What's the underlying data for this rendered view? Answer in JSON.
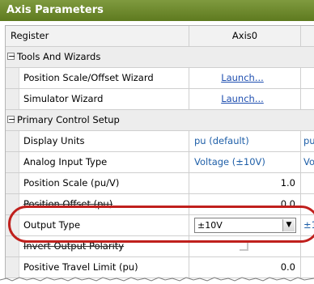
{
  "panel": {
    "title": "Axis Parameters"
  },
  "header": {
    "col_register": "Register",
    "col_axis": "Axis0"
  },
  "categories": {
    "tools": "Tools And Wizards",
    "primary": "Primary Control Setup"
  },
  "tools": {
    "position_scale_wizard": {
      "label": "Position Scale/Offset Wizard",
      "action": "Launch..."
    },
    "simulator_wizard": {
      "label": "Simulator Wizard",
      "action": "Launch..."
    }
  },
  "primary": {
    "display_units": {
      "label": "Display Units",
      "value": "pu (default)",
      "extra": "pu"
    },
    "analog_input_type": {
      "label": "Analog Input Type",
      "value": "Voltage (±10V)",
      "extra": "Vol"
    },
    "position_scale": {
      "label": "Position Scale (pu/V)",
      "value": "1.0"
    },
    "position_offset": {
      "label": "Position Offset (pu)",
      "value": "0.0"
    },
    "output_type": {
      "label": "Output Type",
      "value": "±10V",
      "extra": "±1"
    },
    "invert_output_polarity": {
      "label": "Invert Output Polarity",
      "checked": false
    },
    "positive_travel_limit": {
      "label": "Positive Travel Limit (pu)",
      "value": "0.0"
    }
  },
  "colors": {
    "title_bar": "#6a8a2a",
    "highlight": "#c0201d",
    "value_text": "#1f5fa8"
  }
}
